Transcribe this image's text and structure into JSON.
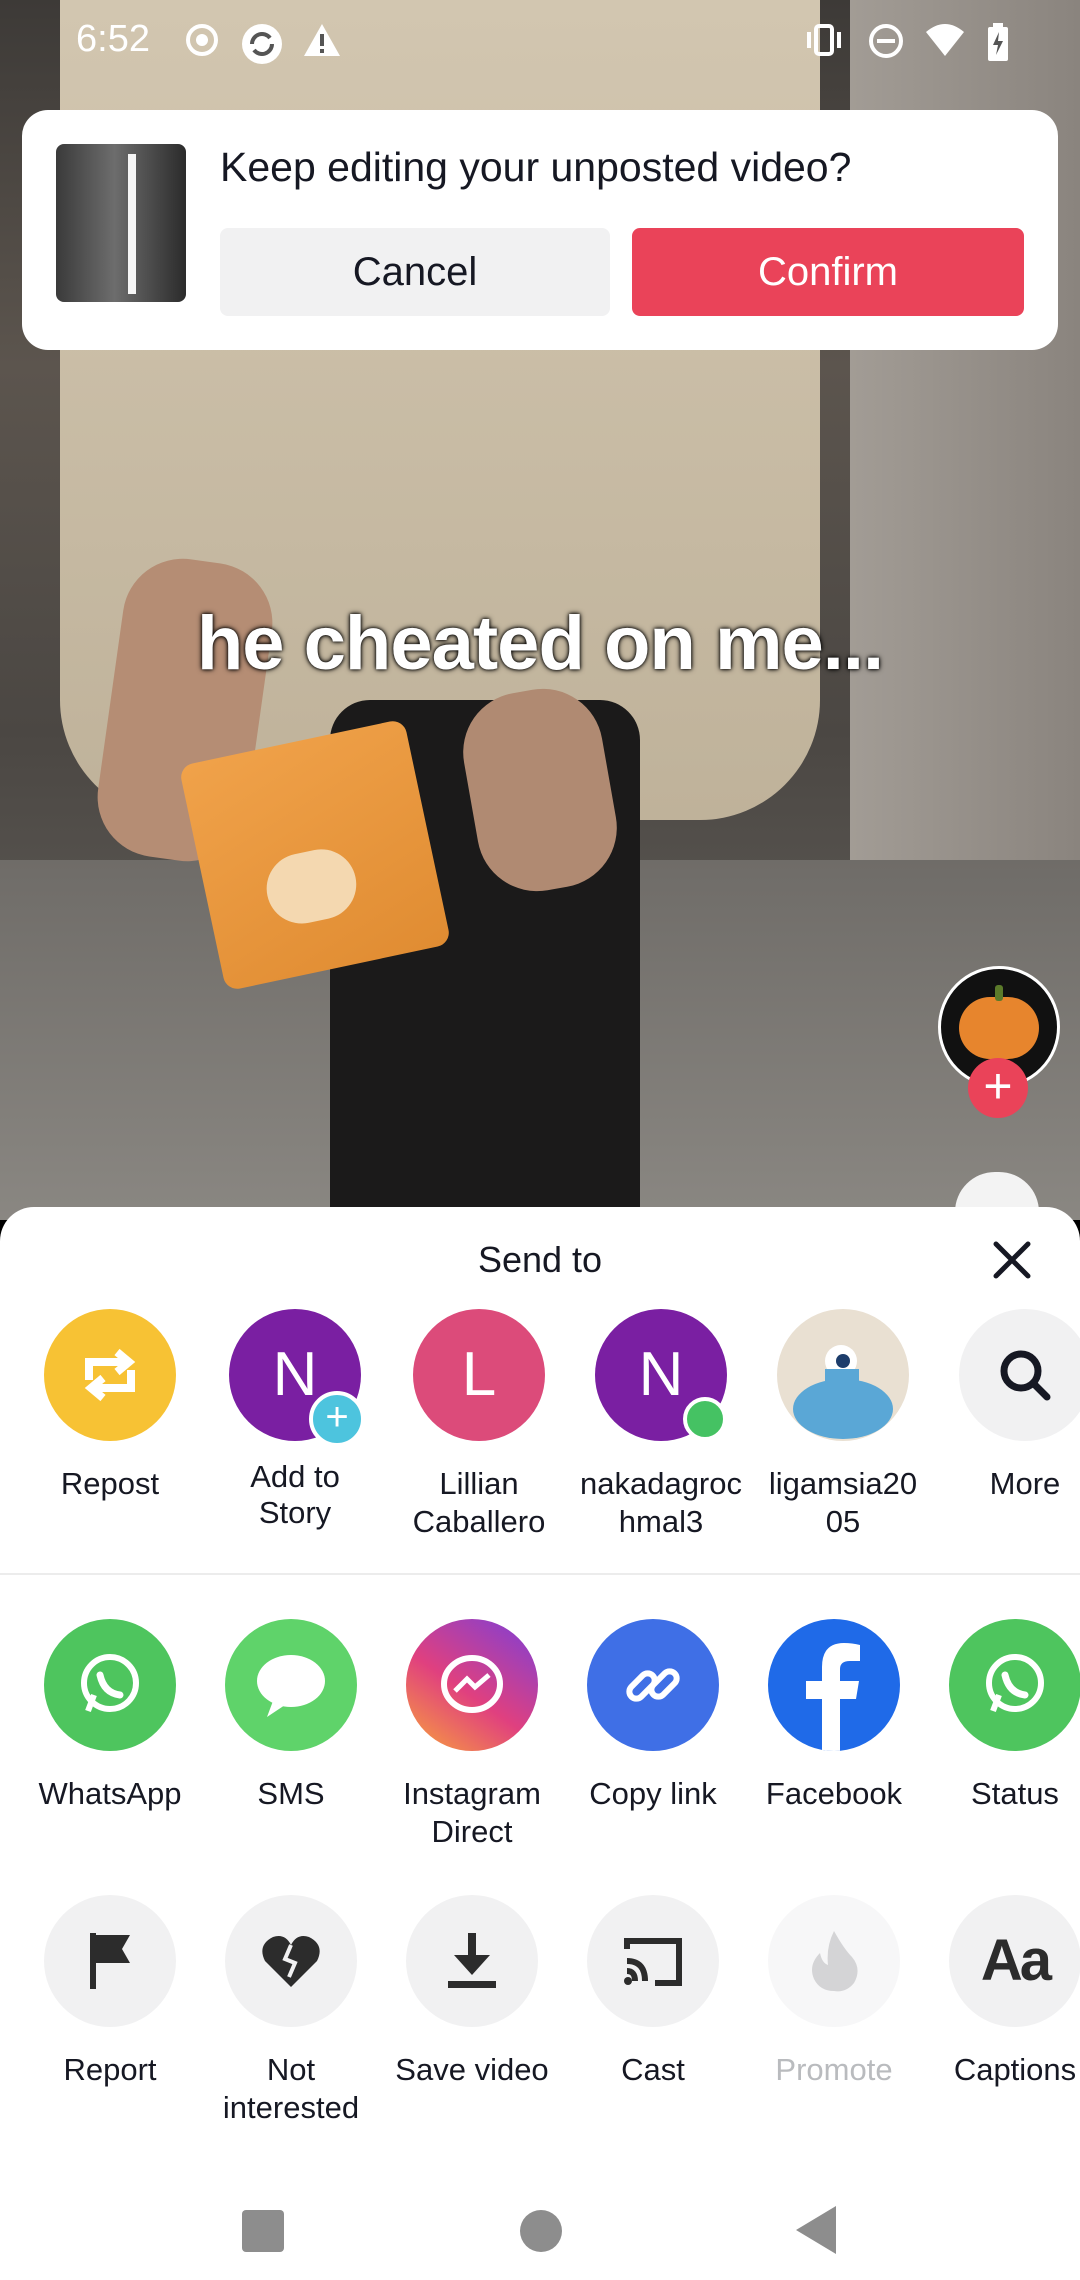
{
  "status_bar": {
    "time": "6:52",
    "icons": [
      "record-icon",
      "sync-icon",
      "warning-icon",
      "vibrate-icon",
      "dnd-icon",
      "wifi-icon",
      "battery-charging-icon"
    ]
  },
  "video": {
    "caption": "he cheated on me..."
  },
  "draft_banner": {
    "title": "Keep editing your unposted video?",
    "cancel_label": "Cancel",
    "confirm_label": "Confirm"
  },
  "share_sheet": {
    "title": "Send to",
    "contacts": [
      {
        "label": "Repost",
        "initial": "",
        "color": "#f7c234"
      },
      {
        "label": "Add to\nStory",
        "initial": "N",
        "color": "#7a1fa2"
      },
      {
        "label": "Lillian\nCaballero",
        "initial": "L",
        "color": "#dc4b7a"
      },
      {
        "label": "nakadagroc\nhmal3",
        "initial": "N",
        "color": "#7a1fa2"
      },
      {
        "label": "ligamsia20\n05",
        "initial": "",
        "color": "#e9e0d2"
      },
      {
        "label": "More",
        "initial": "",
        "color": "#f1f1f2"
      }
    ],
    "apps": [
      {
        "label": "WhatsApp",
        "color": "#4ec55e"
      },
      {
        "label": "SMS",
        "color": "#5fd36a"
      },
      {
        "label": "Instagram\nDirect",
        "color": "#d8408d"
      },
      {
        "label": "Copy link",
        "color": "#3f6fe6"
      },
      {
        "label": "Facebook",
        "color": "#1f6ae8"
      },
      {
        "label": "Status",
        "color": "#4ec55e"
      }
    ],
    "actions": [
      {
        "label": "Report"
      },
      {
        "label": "Not\ninterested"
      },
      {
        "label": "Save video"
      },
      {
        "label": "Cast"
      },
      {
        "label": "Promote"
      },
      {
        "label": "Captions"
      }
    ]
  }
}
